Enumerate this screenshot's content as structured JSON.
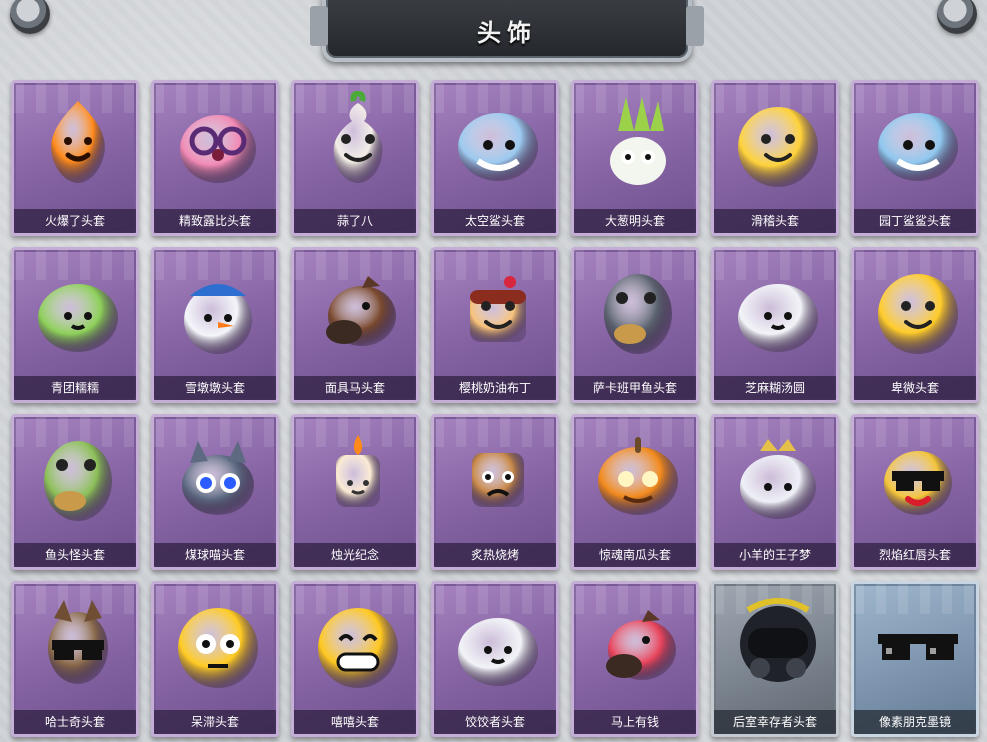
{
  "header": {
    "title": "头饰"
  },
  "items": [
    {
      "label": "火爆了头套",
      "icon": "fire-mascot-head-icon",
      "color": "#ff8a1a",
      "bg": "purple"
    },
    {
      "label": "精致露比头套",
      "icon": "pink-beaver-glasses-head-icon",
      "color": "#f18ab4",
      "bg": "purple"
    },
    {
      "label": "蒜了八",
      "icon": "garlic-face-head-icon",
      "color": "#f3eee6",
      "bg": "purple"
    },
    {
      "label": "太空鲨头套",
      "icon": "space-shark-head-icon",
      "color": "#9cc9ef",
      "bg": "purple"
    },
    {
      "label": "大葱明头套",
      "icon": "green-onion-head-icon",
      "color": "#9bd24a",
      "bg": "purple"
    },
    {
      "label": "滑稽头套",
      "icon": "funny-emoji-head-icon",
      "color": "#ffd23a",
      "bg": "purple"
    },
    {
      "label": "园丁鲨鲨头套",
      "icon": "gardener-shark-head-icon",
      "color": "#8fc7ee",
      "bg": "purple"
    },
    {
      "label": "青团糯糯",
      "icon": "green-rice-ball-head-icon",
      "color": "#8ed05a",
      "bg": "purple"
    },
    {
      "label": "雪墩墩头套",
      "icon": "snowman-head-icon",
      "color": "#f4f6fa",
      "bg": "purple"
    },
    {
      "label": "面具马头套",
      "icon": "horse-mask-head-icon",
      "color": "#7b4a2f",
      "bg": "purple"
    },
    {
      "label": "樱桃奶油布丁",
      "icon": "cherry-pudding-head-icon",
      "color": "#f7c27a",
      "bg": "purple"
    },
    {
      "label": "萨卡班甲鱼头套",
      "icon": "sacabambaspis-fish-head-icon",
      "color": "#5c6470",
      "bg": "purple"
    },
    {
      "label": "芝麻糊汤圆",
      "icon": "rice-dumpling-head-icon",
      "color": "#f2f4f8",
      "bg": "purple"
    },
    {
      "label": "卑微头套",
      "icon": "humble-emoji-head-icon",
      "color": "#ffcc2a",
      "bg": "purple"
    },
    {
      "label": "鱼头怪头套",
      "icon": "fish-head-monster-icon",
      "color": "#8bbf57",
      "bg": "purple"
    },
    {
      "label": "煤球喵头套",
      "icon": "coal-cat-head-icon",
      "color": "#5d6a82",
      "bg": "purple"
    },
    {
      "label": "烛光纪念",
      "icon": "candle-head-icon",
      "color": "#fbead2",
      "bg": "purple"
    },
    {
      "label": "炙热烧烤",
      "icon": "grilled-meat-head-icon",
      "color": "#c98a4a",
      "bg": "purple"
    },
    {
      "label": "惊魂南瓜头套",
      "icon": "pumpkin-head-icon",
      "color": "#f28a1c",
      "bg": "purple"
    },
    {
      "label": "小羊的王子梦",
      "icon": "sheep-prince-head-icon",
      "color": "#eef0f6",
      "bg": "purple"
    },
    {
      "label": "烈焰红唇头套",
      "icon": "red-lips-head-icon",
      "color": "#f4c53a",
      "bg": "purple"
    },
    {
      "label": "哈士奇头套",
      "icon": "husky-sunglasses-head-icon",
      "color": "#8a6a4a",
      "bg": "purple"
    },
    {
      "label": "呆滞头套",
      "icon": "dazed-emoji-head-icon",
      "color": "#ffcb23",
      "bg": "purple"
    },
    {
      "label": "嘻嘻头套",
      "icon": "grinning-emoji-head-icon",
      "color": "#ffc81f",
      "bg": "purple"
    },
    {
      "label": "饺饺者头套",
      "icon": "dumpling-head-icon",
      "color": "#f2f4f8",
      "bg": "purple"
    },
    {
      "label": "马上有钱",
      "icon": "red-horse-head-icon",
      "color": "#e8445b",
      "bg": "purple"
    },
    {
      "label": "后室幸存者头套",
      "icon": "gas-mask-helmet-head-icon",
      "color": "#2b2e35",
      "bg": "gray"
    },
    {
      "label": "像素朋克墨镜",
      "icon": "pixel-sunglasses-icon",
      "color": "#111111",
      "bg": "blue"
    }
  ]
}
